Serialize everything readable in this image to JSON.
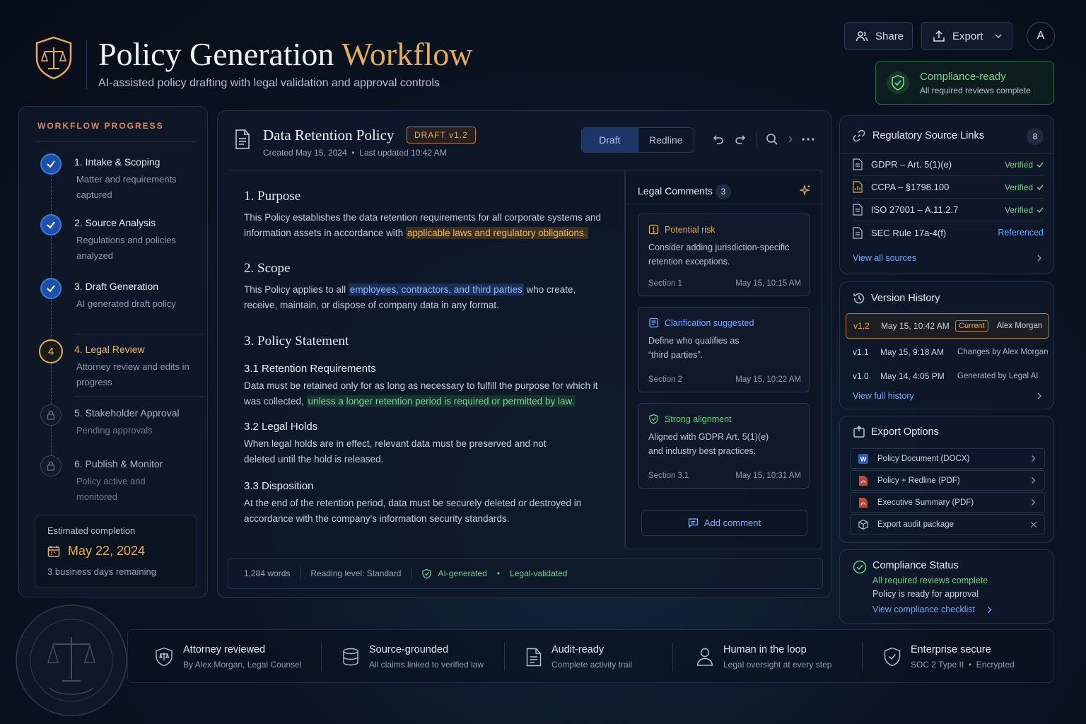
{
  "header": {
    "title_main": "Policy Generation ",
    "title_accent": "Workflow",
    "subtitle": "AI-assisted policy drafting with legal validation and approval controls",
    "share_label": "Share",
    "export_label": "Export",
    "avatar_initial": "A",
    "compliance_title": "Compliance-ready",
    "compliance_sub": "All required reviews complete"
  },
  "workflow": {
    "title": "WORKFLOW PROGRESS",
    "steps": [
      {
        "title": "1. Intake & Scoping",
        "desc": "Matter and requirements captured",
        "status": "done"
      },
      {
        "title": "2. Source Analysis",
        "desc": "Regulations and policies analyzed",
        "status": "done"
      },
      {
        "title": "3. Draft Generation",
        "desc": "AI generated draft policy",
        "status": "done"
      },
      {
        "title": "4. Legal Review",
        "desc": "Attorney review and edits in progress",
        "status": "active",
        "number": "4"
      },
      {
        "title": "5. Stakeholder Approval",
        "desc": "Pending approvals",
        "status": "locked"
      },
      {
        "title": "6. Publish & Monitor",
        "desc": "Policy active and monitored",
        "status": "locked"
      }
    ],
    "eta_label": "Estimated completion",
    "eta_date": "May 22, 2024",
    "eta_remaining": "3 business days remaining"
  },
  "document": {
    "title": "Data Retention Policy",
    "badge": "DRAFT v1.2",
    "meta": "Created May 15, 2024  •  Last updated 10:42 AM",
    "tab_draft": "Draft",
    "tab_redline": "Redline",
    "s1_heading": "1. Purpose",
    "s1_text": "This Policy establishes the data retention requirements for all corporate systems and information assets in accordance with ",
    "s1_highlight": "applicable laws and regulatory obligations.",
    "s2_heading": "2. Scope",
    "s2_pre": "This Policy applies to all ",
    "s2_highlight": "employees, contractors, and third parties",
    "s2_post": " who create, receive, maintain, or dispose of company data in any format.",
    "s3_heading": "3. Policy Statement",
    "s31_heading": "3.1  Retention Requirements",
    "s31_pre": "Data must be retained only for as long as necessary to fulfill the purpose for which it was collected, ",
    "s31_highlight": "unless a longer retention period is required or permitted by law.",
    "s32_heading": "3.2  Legal Holds",
    "s32_text": "When legal holds are in effect, relevant data must be preserved and not deleted until the hold is released.",
    "s33_heading": "3.3  Disposition",
    "s33_text": "At the end of the retention period, data must be securely deleted or destroyed in accordance with the company's information security standards.",
    "footer_words": "1,284 words",
    "footer_reading": "Reading level: Standard",
    "footer_ai": "AI-generated",
    "footer_dot": "•",
    "footer_legal": "Legal-validated"
  },
  "comments": {
    "title": "Legal Comments",
    "count": "3",
    "items": [
      {
        "type": "Potential risk",
        "text": "Consider adding jurisdiction-specific retention exceptions.",
        "section": "Section 1",
        "time": "May 15, 10:15 AM"
      },
      {
        "type": "Clarification suggested",
        "text": "Define who qualifies as “third parties”.",
        "section": "Section 2",
        "time": "May 15, 10:22 AM"
      },
      {
        "type": "Strong alignment",
        "text": "Aligned with GDPR Art. 5(1)(e) and industry best practices.",
        "section": "Section 3.1",
        "time": "May 15, 10:31 AM"
      }
    ],
    "add_label": "Add comment"
  },
  "sources": {
    "title": "Regulatory Source Links",
    "count": "8",
    "items": [
      {
        "label": "GDPR – Art. 5(1)(e)",
        "status": "Verified"
      },
      {
        "label": "CCPA – §1798.100",
        "status": "Verified"
      },
      {
        "label": "ISO 27001 – A.11.2.7",
        "status": "Verified"
      },
      {
        "label": "SEC Rule 17a-4(f)",
        "status": "Referenced"
      }
    ],
    "view_all": "View all sources"
  },
  "versions": {
    "title": "Version History",
    "items": [
      {
        "ver": "v1.2",
        "date": "May 15, 10:42 AM",
        "tag": "Current",
        "who": "Alex Morgan"
      },
      {
        "ver": "v1.1",
        "date": "May 15, 9:18 AM",
        "tag": "",
        "who": "Changes by Alex Morgan"
      },
      {
        "ver": "v1.0",
        "date": "May 14, 4:05 PM",
        "tag": "",
        "who": "Generated by Legal AI"
      }
    ],
    "view_full": "View full history"
  },
  "exports": {
    "title": "Export Options",
    "items": [
      {
        "label": "Policy Document (DOCX)",
        "icon": "word-icon"
      },
      {
        "label": "Policy + Redline (PDF)",
        "icon": "pdf-icon"
      },
      {
        "label": "Executive Summary (PDF)",
        "icon": "pdf-icon"
      },
      {
        "label": "Export audit package",
        "icon": "package-icon"
      }
    ]
  },
  "compliance_status": {
    "title": "Compliance Status",
    "line1": "All required reviews complete",
    "line2": "Policy is ready for approval",
    "link": "View compliance checklist"
  },
  "bottom": {
    "items": [
      {
        "title": "Attorney reviewed",
        "sub": "By Alex Morgan, Legal Counsel"
      },
      {
        "title": "Source-grounded",
        "sub": "All claims linked to verified law"
      },
      {
        "title": "Audit-ready",
        "sub": "Complete activity trail"
      },
      {
        "title": "Human in the loop",
        "sub": "Legal oversight at every step"
      },
      {
        "title": "Enterprise secure",
        "sub": "SOC 2 Type II  •  Encrypted"
      }
    ]
  },
  "colors": {
    "accent_gold": "#e3ab5d",
    "accent_blue": "#6ea8ff",
    "accent_green": "#6fd08b",
    "accent_orange": "#e2865a"
  }
}
